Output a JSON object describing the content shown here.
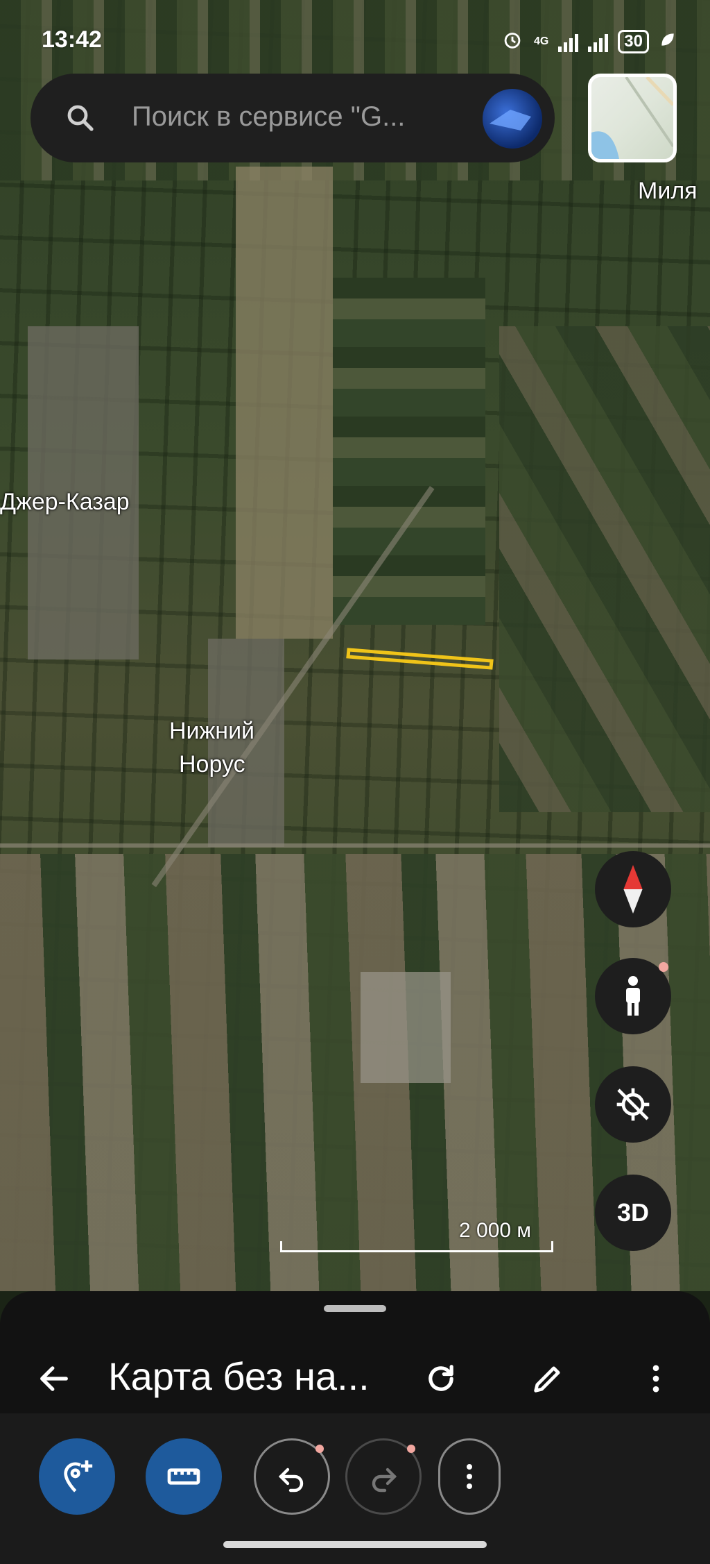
{
  "status_bar": {
    "time": "13:42",
    "network": "4G",
    "battery": "30"
  },
  "search": {
    "placeholder": "Поиск в сервисе \"G..."
  },
  "map": {
    "labels": {
      "miliya": "Миля",
      "dzher_kazar": "Джер-Казар",
      "nizhniy_line1": "Нижний",
      "nizhniy_line2": "Норус"
    },
    "scale": "2 000 м",
    "measure_line_color": "#f0c419"
  },
  "controls": {
    "btn_3d": "3D"
  },
  "sheet": {
    "title": "Карта без на..."
  },
  "icons": {
    "search": "search-icon",
    "compass": "compass-icon",
    "pegman": "pegman-icon",
    "location": "location-off-icon",
    "back": "arrow-back-icon",
    "refresh": "refresh-icon",
    "edit": "pencil-icon",
    "more": "more-vert-icon",
    "add_place": "add-place-icon",
    "measure": "ruler-icon",
    "undo": "undo-icon",
    "redo": "redo-icon"
  },
  "colors": {
    "accent_blue": "#1e5a9c",
    "dark_surface": "#1e1e1e"
  }
}
